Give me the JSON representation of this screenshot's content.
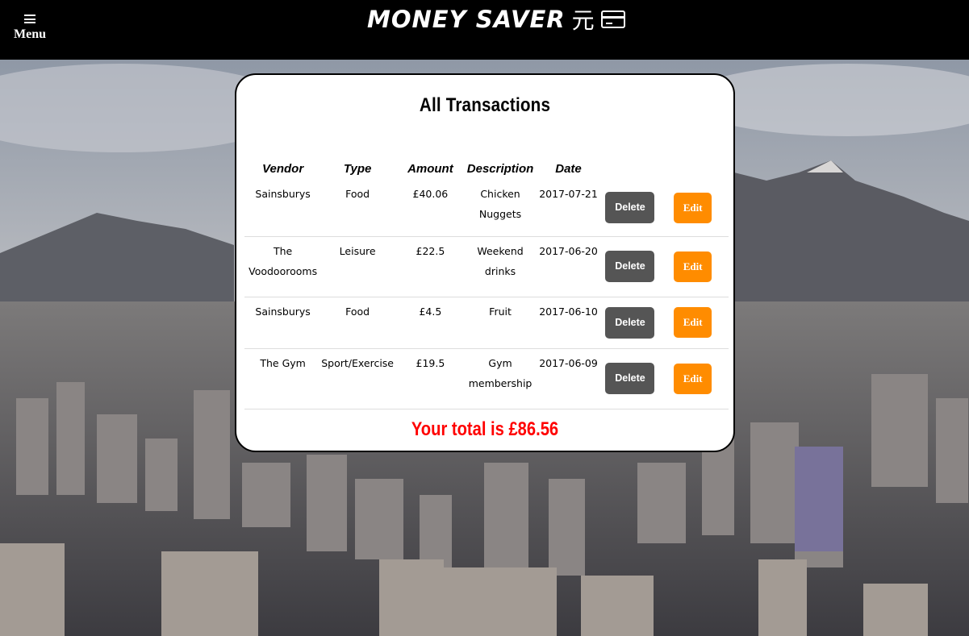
{
  "header": {
    "menu_label": "Menu",
    "brand_title": "MONEY SAVER",
    "brand_symbol": "元",
    "menu_icon": "hamburger-icon",
    "card_icon": "credit-card-icon"
  },
  "transactions": {
    "title": "All Transactions",
    "columns": [
      "Vendor",
      "Type",
      "Amount",
      "Description",
      "Date"
    ],
    "rows": [
      {
        "vendor": "Sainsburys",
        "type": "Food",
        "amount": "£40.06",
        "description": "Chicken Nuggets",
        "date": "2017-07-21",
        "delete_label": "Delete",
        "edit_label": "Edit"
      },
      {
        "vendor": "The Voodoorooms",
        "type": "Leisure",
        "amount": "£22.5",
        "description": "Weekend drinks",
        "date": "2017-06-20",
        "delete_label": "Delete",
        "edit_label": "Edit"
      },
      {
        "vendor": "Sainsburys",
        "type": "Food",
        "amount": "£4.5",
        "description": "Fruit",
        "date": "2017-06-10",
        "delete_label": "Delete",
        "edit_label": "Edit"
      },
      {
        "vendor": "The Gym",
        "type": "Sport/Exercise",
        "amount": "£19.5",
        "description": "Gym membership",
        "date": "2017-06-09",
        "delete_label": "Delete",
        "edit_label": "Edit"
      }
    ],
    "total_text": "Your total is £86.56"
  },
  "colors": {
    "topbar": "#000000",
    "delete_button": "#555555",
    "edit_button": "#ff8c00",
    "total_text": "#ff0000"
  }
}
